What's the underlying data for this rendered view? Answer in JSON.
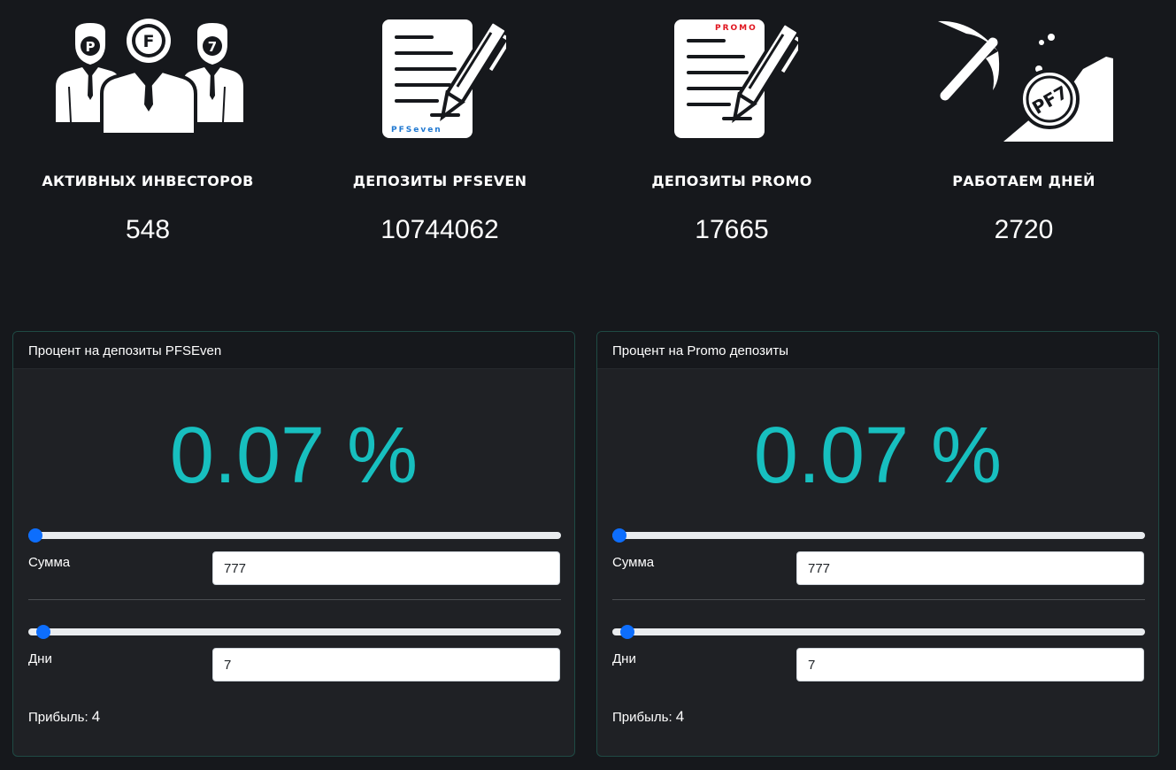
{
  "stats": [
    {
      "icon": "investors-icon",
      "label": "АКТИВНЫХ ИНВЕСТОРОВ",
      "value": "548",
      "icon_badges": [
        "P",
        "F",
        "7"
      ]
    },
    {
      "icon": "pfseven-deposit-document-icon",
      "label": "ДЕПОЗИТЫ PFSEVEN",
      "value": "10744062",
      "icon_text": "PFSeven"
    },
    {
      "icon": "promo-deposit-document-icon",
      "label": "ДЕПОЗИТЫ PROMO",
      "value": "17665",
      "icon_text": "PROMO"
    },
    {
      "icon": "mining-pickaxe-icon",
      "label": "РАБОТАЕМ ДНЕЙ",
      "value": "2720",
      "icon_text": "PF7"
    }
  ],
  "calculators": [
    {
      "title": "Процент на депозиты PFSEven",
      "percent": "0.07 %",
      "amount_label": "Сумма",
      "amount_value": "777",
      "amount_slider_fraction": 0.0,
      "days_label": "Дни",
      "days_value": "7",
      "days_slider_fraction": 0.015,
      "profit_label": "Прибыль:",
      "profit_value": "4"
    },
    {
      "title": "Процент на Promo депозиты",
      "percent": "0.07 %",
      "amount_label": "Сумма",
      "amount_value": "777",
      "amount_slider_fraction": 0.0,
      "days_label": "Дни",
      "days_value": "7",
      "days_slider_fraction": 0.015,
      "profit_label": "Прибыль:",
      "profit_value": "4"
    }
  ],
  "colors": {
    "background": "#16181c",
    "card_background": "#1f2125",
    "card_border": "#1f4a44",
    "percent_text": "#17bfbf",
    "slider_thumb": "#0d6efd",
    "slider_track": "#e9ecef",
    "promo_red": "#e0141e",
    "pfseven_blue": "#1f78d1"
  }
}
